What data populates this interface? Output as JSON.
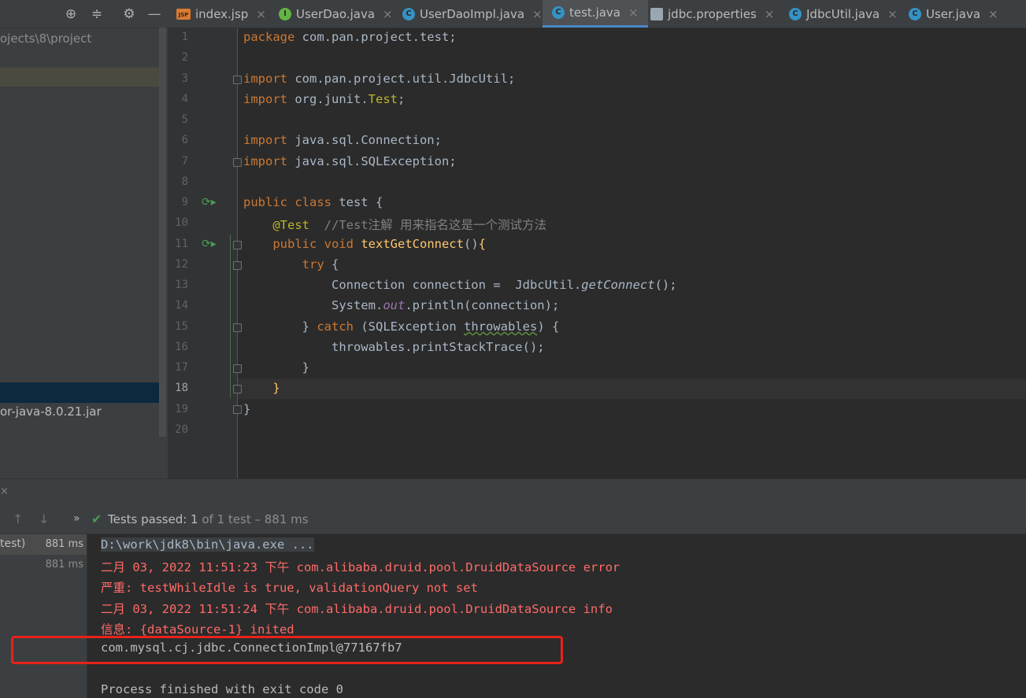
{
  "project_panel": {
    "path_fragment": "ojects\\8\\project",
    "jar_fragment": "or-java-8.0.21.jar"
  },
  "tabs": [
    {
      "label": "index.jsp",
      "icon": "jsp-file-icon",
      "badge": "JSP",
      "active": false
    },
    {
      "label": "UserDao.java",
      "icon": "interface-icon",
      "badge": "I",
      "active": false
    },
    {
      "label": "UserDaoImpl.java",
      "icon": "class-icon",
      "badge": "C",
      "active": false
    },
    {
      "label": "test.java",
      "icon": "class-icon",
      "badge": "C",
      "active": true
    },
    {
      "label": "jdbc.properties",
      "icon": "properties-file-icon",
      "badge": "",
      "active": false
    },
    {
      "label": "JdbcUtil.java",
      "icon": "class-icon",
      "badge": "C",
      "active": false
    },
    {
      "label": "User.java",
      "icon": "class-icon",
      "badge": "C",
      "active": false
    }
  ],
  "editor": {
    "current_line": 18,
    "line_numbers": [
      "1",
      "2",
      "3",
      "4",
      "5",
      "6",
      "7",
      "8",
      "9",
      "10",
      "11",
      "12",
      "13",
      "14",
      "15",
      "16",
      "17",
      "18",
      "19",
      "20"
    ]
  },
  "run": {
    "status_prefix": "Tests passed: ",
    "passed": "1",
    "status_suffix": " of 1 test – 881 ms",
    "tree_items": [
      {
        "label": "test)",
        "time": "881 ms"
      },
      {
        "label": "",
        "time": "881 ms"
      }
    ],
    "console_lines": [
      {
        "text": "D:\\work\\jdk8\\bin\\java.exe ...",
        "kind": "command"
      },
      {
        "text": "二月 03, 2022 11:51:23 下午 com.alibaba.druid.pool.DruidDataSource error",
        "kind": "error"
      },
      {
        "text": "严重: testWhileIdle is true, validationQuery not set",
        "kind": "error"
      },
      {
        "text": "二月 03, 2022 11:51:24 下午 com.alibaba.druid.pool.DruidDataSource info",
        "kind": "error"
      },
      {
        "text": "信息: {dataSource-1} inited",
        "kind": "error"
      },
      {
        "text": "com.mysql.cj.jdbc.ConnectionImpl@77167fb7",
        "kind": "output"
      },
      {
        "text": "",
        "kind": "output"
      },
      {
        "text": "Process finished with exit code 0",
        "kind": "output"
      }
    ]
  },
  "colors": {
    "accent": "#4a88c7",
    "keyword": "#cc7832",
    "annotation": "#bbb529",
    "function": "#ffc66d",
    "error_text": "#ff6b68",
    "highlight_box": "#e8221b",
    "pass_check": "#499c54"
  }
}
